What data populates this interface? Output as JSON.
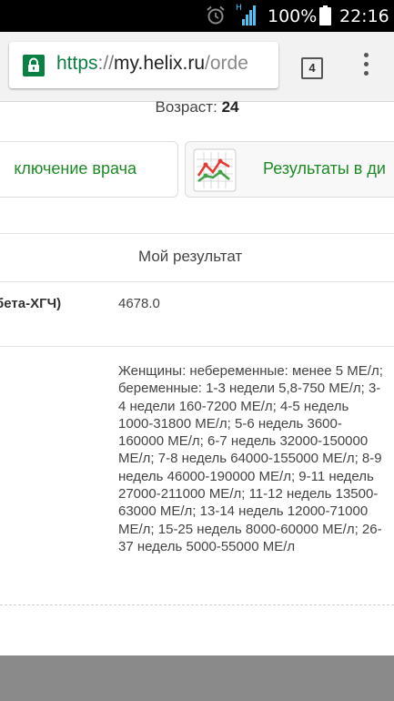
{
  "status_bar": {
    "battery": "100%",
    "time": "22:16",
    "network_type": "H"
  },
  "browser": {
    "url_scheme": "https",
    "url_separator": "://",
    "url_host": "my.helix.ru",
    "url_path": "/orde",
    "tab_count": "4"
  },
  "page": {
    "age_label": "Возраст:",
    "age_value": "24",
    "button_conclusion": "ключение врача",
    "button_results": "Результаты в ди",
    "table_header_result": "Мой результат",
    "test_name": "(бета-ХГЧ)",
    "test_value": "4678.0",
    "reference_norm": "Женщины: небеременные: менее 5 МЕ/л; беременные: 1-3 недели 5,8-750 МЕ/л; 3-4 недели 160-7200 МЕ/л; 4-5 недель 1000-31800 МЕ/л; 5-6 недель 3600-160000 МЕ/л; 6-7 недель 32000-150000 МЕ/л; 7-8 недель 64000-155000 МЕ/л; 8-9 недель 46000-190000 МЕ/л; 9-11 недель 27000-211000 МЕ/л; 11-12 недель 13500-63000 МЕ/л; 13-14 недель 12000-71000 МЕ/л; 15-25 недель 8000-60000 МЕ/л; 26-37 недель 5000-55000 МЕ/л"
  },
  "colors": {
    "status_bar_bg": "#000000",
    "secure_green": "#0b8043",
    "button_text_green": "#1e8a26",
    "footer_gray": "#8a8a8a"
  },
  "icons": {
    "alarm": "alarm-clock-icon",
    "signal": "signal-strength-icon",
    "battery": "battery-icon",
    "lock": "lock-icon",
    "tabs": "tab-switcher-icon",
    "menu": "overflow-menu-icon",
    "chart": "line-chart-icon"
  }
}
